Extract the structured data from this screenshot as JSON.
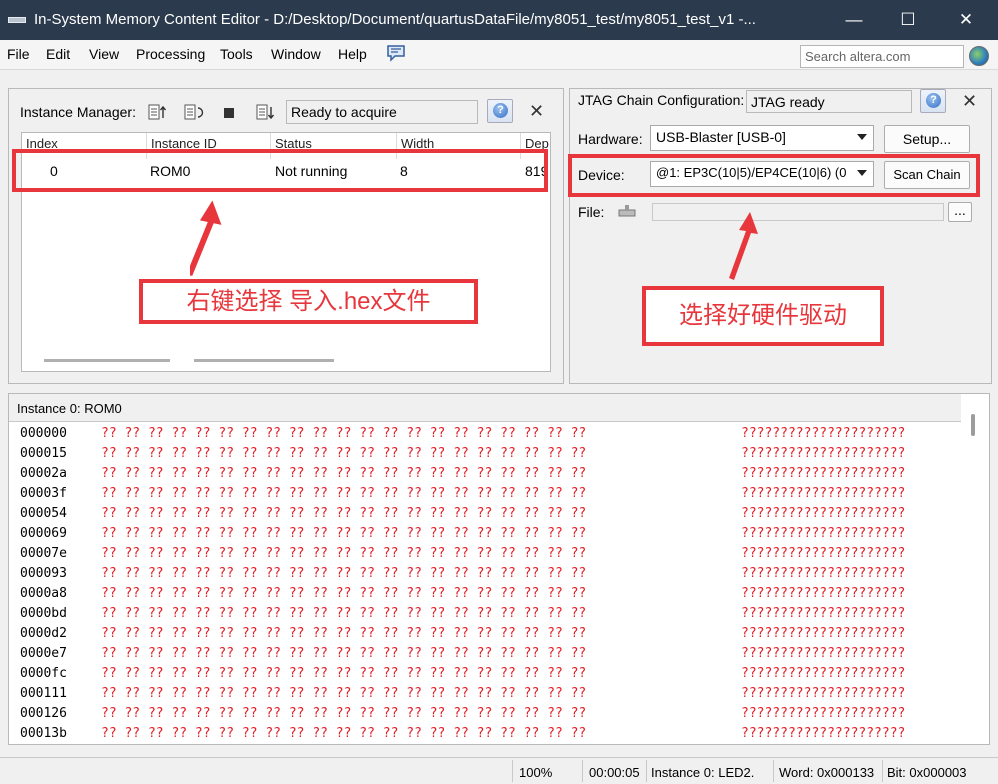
{
  "window": {
    "title": "In-System Memory Content Editor - D:/Desktop/Document/quartusDataFile/my8051_test/my8051_test_v1 -...",
    "minimize": "—",
    "maximize": "☐",
    "close": "✕"
  },
  "menu": {
    "items": [
      "File",
      "Edit",
      "View",
      "Processing",
      "Tools",
      "Window",
      "Help"
    ],
    "search_placeholder": "Search altera.com"
  },
  "instance_manager": {
    "label": "Instance Manager:",
    "status": "Ready to acquire",
    "columns": [
      "Index",
      "Instance ID",
      "Status",
      "Width",
      "Dep"
    ],
    "rows": [
      {
        "index": "0",
        "instance_id": "ROM0",
        "status": "Not running",
        "width": "8",
        "depth": "819"
      }
    ]
  },
  "jtag": {
    "label": "JTAG Chain Configuration:",
    "status": "JTAG ready",
    "hardware_label": "Hardware:",
    "hardware_value": "USB-Blaster [USB-0]",
    "setup_button": "Setup...",
    "device_label": "Device:",
    "device_value": "@1: EP3C(10|5)/EP4CE(10|6) (0",
    "scan_button": "Scan Chain",
    "file_label": "File:",
    "browse_button": "..."
  },
  "annotations": {
    "left_note": "右键选择  导入.hex文件",
    "right_note": "选择好硬件驱动"
  },
  "memory": {
    "header": "Instance 0: ROM0",
    "addresses": [
      "000000",
      "000015",
      "00002a",
      "00003f",
      "000054",
      "000069",
      "00007e",
      "000093",
      "0000a8",
      "0000bd",
      "0000d2",
      "0000e7",
      "0000fc",
      "000111",
      "000126",
      "00013b"
    ],
    "cells": "?? ?? ?? ?? ?? ?? ?? ?? ?? ?? ?? ?? ?? ?? ?? ?? ?? ?? ?? ?? ??",
    "ascii": "?????????????????????"
  },
  "statusbar": {
    "zoom": "100%",
    "time": "00:00:05",
    "instance": "Instance 0: LED2.",
    "word": "Word: 0x000133",
    "bit": "Bit: 0x000003"
  },
  "colors": {
    "accent_red": "#e8373c",
    "hex_text": "#e21f26",
    "titlebar": "#2b3a4d"
  }
}
